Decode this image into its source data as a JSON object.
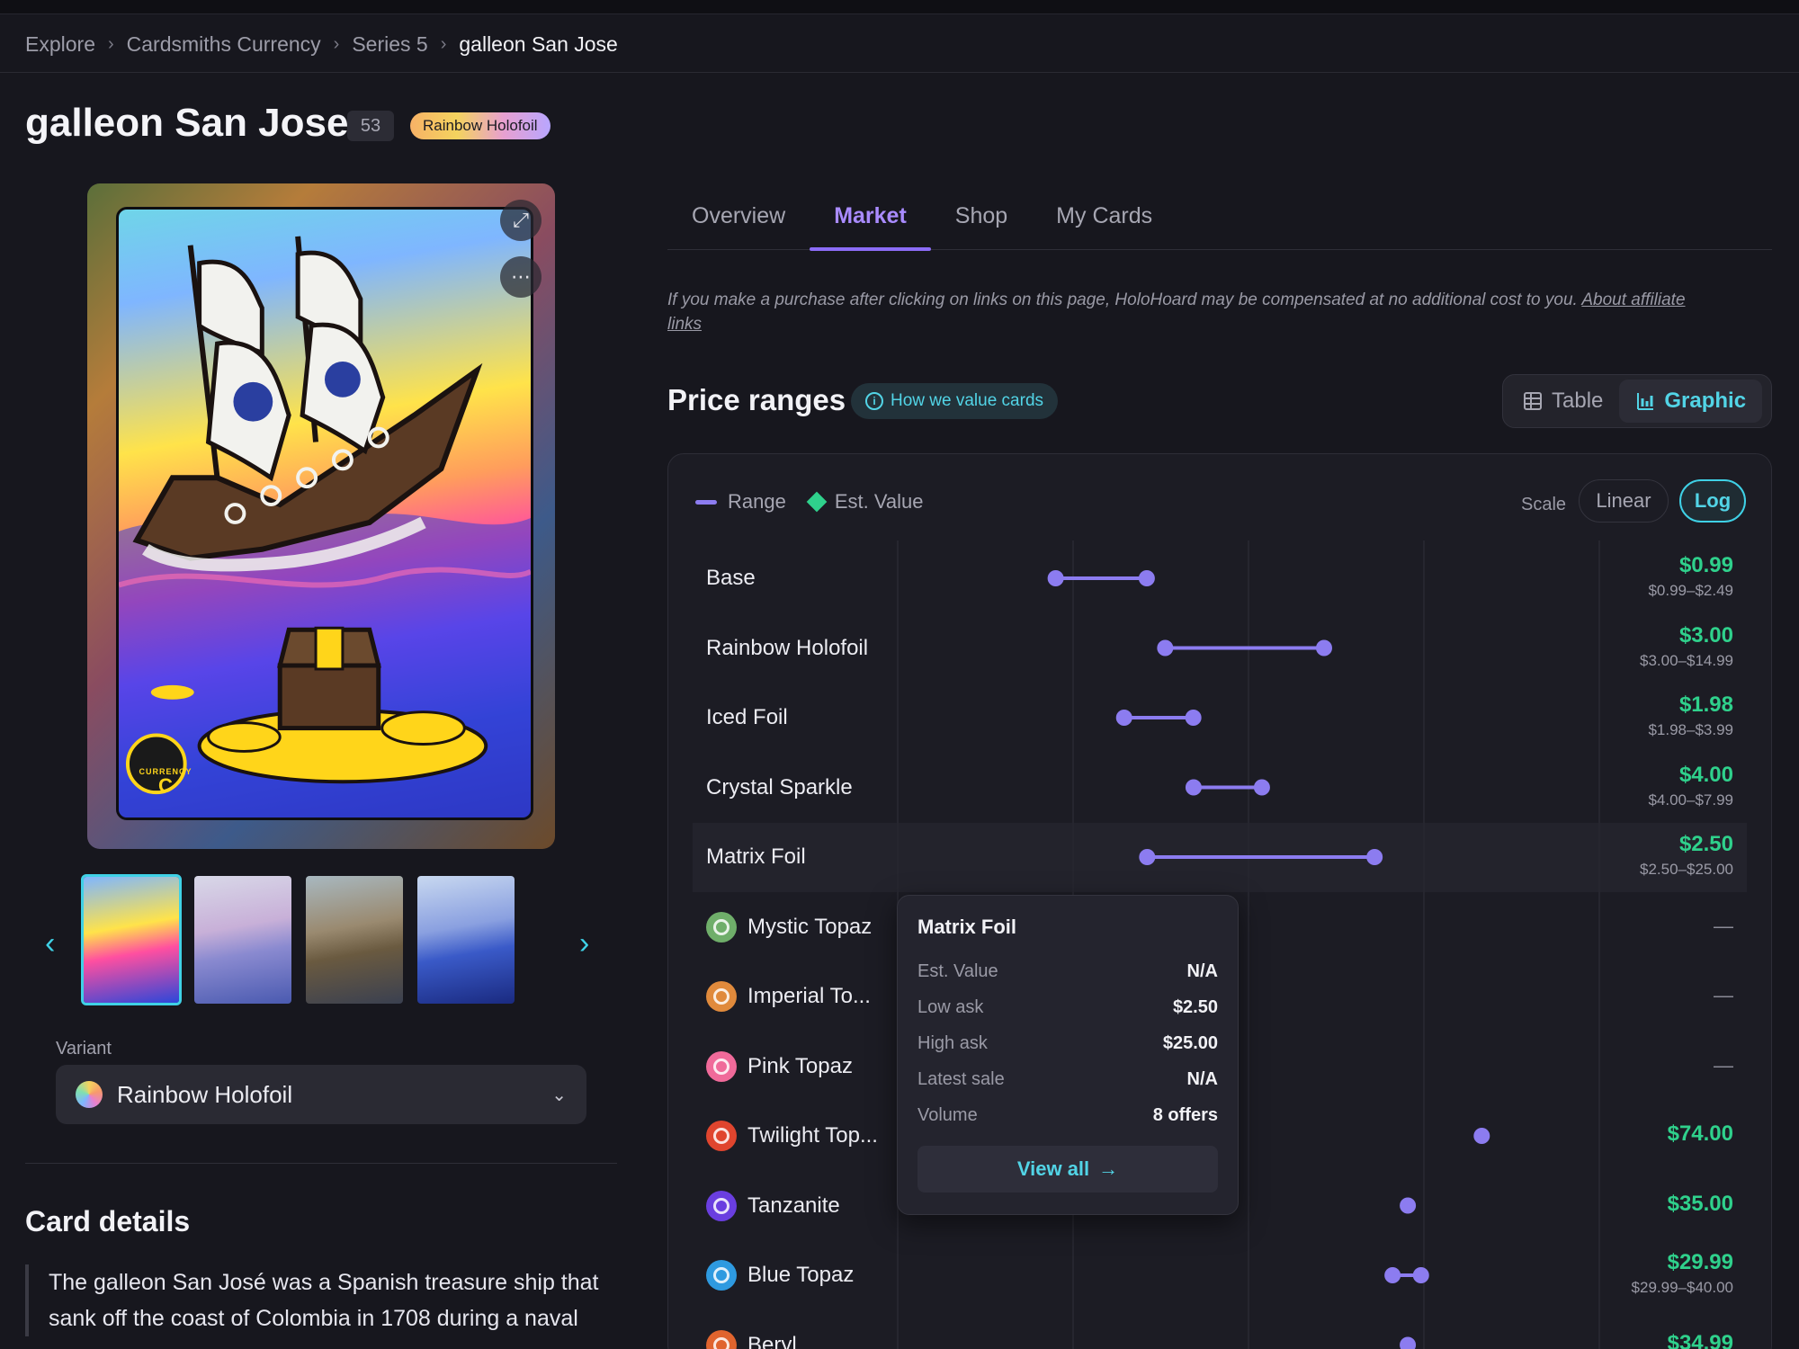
{
  "breadcrumb": {
    "items": [
      "Explore",
      "Cardsmiths Currency",
      "Series 5"
    ],
    "current": "galleon San Jose"
  },
  "card": {
    "title": "galleon San Jose",
    "number": "53",
    "variant_badge": "Rainbow Holofoil",
    "seal_text": "CURRENCY",
    "seal_letter": "C"
  },
  "thumbnails": {
    "count": 4,
    "active_index": 0
  },
  "variant": {
    "label": "Variant",
    "selected": "Rainbow Holofoil"
  },
  "details": {
    "title": "Card details",
    "body": "The galleon San José was a Spanish treasure ship that sank off the coast of Colombia in 1708 during a naval"
  },
  "tabs": [
    {
      "label": "Overview",
      "active": false
    },
    {
      "label": "Market",
      "active": true
    },
    {
      "label": "Shop",
      "active": false
    },
    {
      "label": "My Cards",
      "active": false
    }
  ],
  "disclaimer": {
    "text": "If you make a purchase after clicking on links on this page, HoloHoard may be compensated at no additional cost to you.",
    "link_a": "About affiliate",
    "link_b": "links"
  },
  "price_ranges": {
    "title": "Price ranges",
    "how_button": "How we value cards",
    "view_table": "Table",
    "view_graphic": "Graphic",
    "legend_range": "Range",
    "legend_est": "Est. Value",
    "scale_label": "Scale",
    "scale_linear": "Linear",
    "scale_log": "Log",
    "active_scale": "Log",
    "colors": {
      "range": "#8c7cf0",
      "est_value": "#2fd18c",
      "accent": "#3fd1e6"
    }
  },
  "chart_data": {
    "type": "range",
    "scale": "log",
    "rows": [
      {
        "name": "Base",
        "low": 0.99,
        "high": 2.49,
        "est": "$0.99",
        "range": "$0.99–$2.49",
        "icon": "none"
      },
      {
        "name": "Rainbow Holofoil",
        "low": 3.0,
        "high": 14.99,
        "est": "$3.00",
        "range": "$3.00–$14.99",
        "icon": "none"
      },
      {
        "name": "Iced Foil",
        "low": 1.98,
        "high": 3.99,
        "est": "$1.98",
        "range": "$1.98–$3.99",
        "icon": "none"
      },
      {
        "name": "Crystal Sparkle",
        "low": 4.0,
        "high": 7.99,
        "est": "$4.00",
        "range": "$4.00–$7.99",
        "icon": "none"
      },
      {
        "name": "Matrix Foil",
        "low": 2.5,
        "high": 25.0,
        "est": "$2.50",
        "range": "$2.50–$25.00",
        "icon": "none",
        "highlighted": true
      },
      {
        "name": "Mystic Topaz",
        "low": null,
        "high": null,
        "est": "—",
        "range": "",
        "icon": "mystic-topaz-icon",
        "color": "#6fae6a"
      },
      {
        "name": "Imperial To...",
        "low": null,
        "high": null,
        "est": "—",
        "range": "",
        "icon": "imperial-topaz-icon",
        "color": "#e08a3c"
      },
      {
        "name": "Pink Topaz",
        "low": null,
        "high": null,
        "est": "—",
        "range": "",
        "icon": "pink-topaz-icon",
        "color": "#f06a9a"
      },
      {
        "name": "Twilight Top...",
        "low": 74.0,
        "high": 74.0,
        "est": "$74.00",
        "range": "",
        "icon": "twilight-topaz-icon",
        "color": "#e0452e"
      },
      {
        "name": "Tanzanite",
        "low": 35.0,
        "high": 35.0,
        "est": "$35.00",
        "range": "",
        "icon": "tanzanite-icon",
        "color": "#6a3ee0"
      },
      {
        "name": "Blue Topaz",
        "low": 29.99,
        "high": 40.0,
        "est": "$29.99",
        "range": "$29.99–$40.00",
        "icon": "blue-topaz-icon",
        "color": "#2e9ae0"
      },
      {
        "name": "Beryl",
        "low": 34.99,
        "high": 34.99,
        "est": "$34.99",
        "range": "",
        "icon": "beryl-icon",
        "color": "#e0642e"
      }
    ]
  },
  "tooltip": {
    "title": "Matrix Foil",
    "rows": [
      {
        "k": "Est. Value",
        "v": "N/A"
      },
      {
        "k": "Low ask",
        "v": "$2.50"
      },
      {
        "k": "High ask",
        "v": "$25.00"
      },
      {
        "k": "Latest sale",
        "v": "N/A"
      },
      {
        "k": "Volume",
        "v": "8 offers"
      }
    ],
    "view_all": "View all"
  }
}
